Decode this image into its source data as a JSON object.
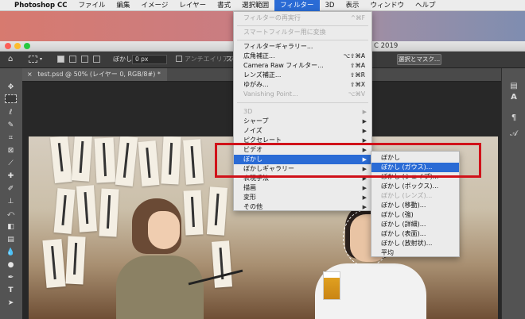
{
  "menubar": {
    "app_name": "Photoshop CC",
    "items": [
      "ファイル",
      "編集",
      "イメージ",
      "レイヤー",
      "書式",
      "選択範囲",
      "フィルター",
      "3D",
      "表示",
      "ウィンドウ",
      "ヘルプ"
    ]
  },
  "window": {
    "title_suffix": "C 2019"
  },
  "options": {
    "feather_label": "ぼかし：",
    "feather_value": "0 px",
    "antialias_label": "アンチエイリアス",
    "style_label": "スタ",
    "select_mask_button": "選択とマスク..."
  },
  "document_tab": {
    "close": "×",
    "title": "test.psd @ 50% (レイヤー 0, RGB/8#) *"
  },
  "filter_menu": {
    "items": [
      {
        "label": "フィルターの再実行",
        "shortcut": "^⌘F",
        "disabled": true
      },
      {
        "label": "スマートフィルター用に変換",
        "disabled": true
      },
      {
        "label": "フィルターギャラリー..."
      },
      {
        "label": "広角補正...",
        "shortcut": "⌥⇧⌘A"
      },
      {
        "label": "Camera Raw フィルター...",
        "shortcut": "⇧⌘A"
      },
      {
        "label": "レンズ補正...",
        "shortcut": "⇧⌘R"
      },
      {
        "label": "ゆがみ...",
        "shortcut": "⇧⌘X"
      },
      {
        "label": "Vanishing Point...",
        "shortcut": "⌥⌘V",
        "disabled": true
      },
      {
        "label": "3D",
        "submenu": true,
        "disabled": true
      },
      {
        "label": "シャープ",
        "submenu": true
      },
      {
        "label": "ノイズ",
        "submenu": true
      },
      {
        "label": "ピクセレート",
        "submenu": true
      },
      {
        "label": "ビデオ",
        "submenu": true
      },
      {
        "label": "ぼかし",
        "submenu": true,
        "highlighted": true
      },
      {
        "label": "ぼかしギャラリー",
        "submenu": true
      },
      {
        "label": "表現手法",
        "submenu": true
      },
      {
        "label": "描画",
        "submenu": true
      },
      {
        "label": "変形",
        "submenu": true
      },
      {
        "label": "その他",
        "submenu": true
      }
    ]
  },
  "blur_submenu": {
    "items": [
      {
        "label": "ぼかし"
      },
      {
        "label": "ぼかし (ガウス)...",
        "highlighted": true
      },
      {
        "label": "ぼかし (シェイプ)..."
      },
      {
        "label": "ぼかし (ボックス)..."
      },
      {
        "label": "ぼかし (レンズ)...",
        "disabled": true
      },
      {
        "label": "ぼかし (移動)..."
      },
      {
        "label": "ぼかし (強)"
      },
      {
        "label": "ぼかし (詳細)..."
      },
      {
        "label": "ぼかし (表面)..."
      },
      {
        "label": "ぼかし (放射状)..."
      },
      {
        "label": "平均"
      }
    ]
  },
  "right_panel": {
    "type_icon": "A",
    "script_icon": "𝒜"
  },
  "colors": {
    "menu_highlight": "#2a6bd5",
    "annotation_red": "#d0121a"
  }
}
